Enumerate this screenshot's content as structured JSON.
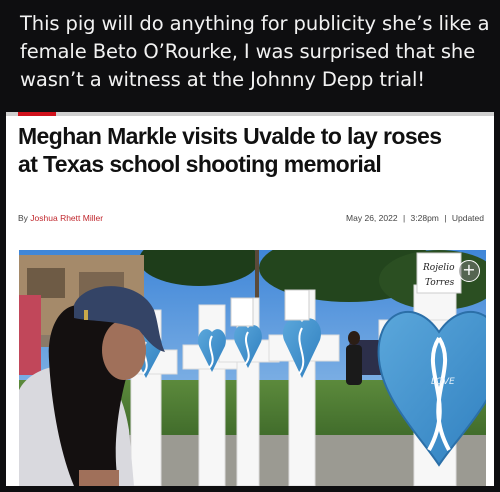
{
  "post": {
    "caption": "This pig will do anything for publicity she’s like a female Beto O’Rourke, I was surprised that she wasn’t a witness at the Johnny Depp trial!"
  },
  "article": {
    "headline": "Meghan Markle visits Uvalde to lay roses at Texas school shooting memorial",
    "byline_prefix": "By",
    "author": "Joshua Rhett Miller",
    "date": "May 26, 2022",
    "time": "3:28pm",
    "updated_label": "Updated",
    "separator": "|",
    "photo": {
      "cross_label_line1": "Rojelio",
      "cross_label_line2": "Torres",
      "expand_icon": "plus-icon",
      "expand_symbol": "+"
    }
  },
  "colors": {
    "background": "#0e0e10",
    "caption_text": "#f2f2f2",
    "brand_red": "#d0111b",
    "author_red": "#c0272d",
    "ribbon_blue": "#4f9ed1"
  }
}
